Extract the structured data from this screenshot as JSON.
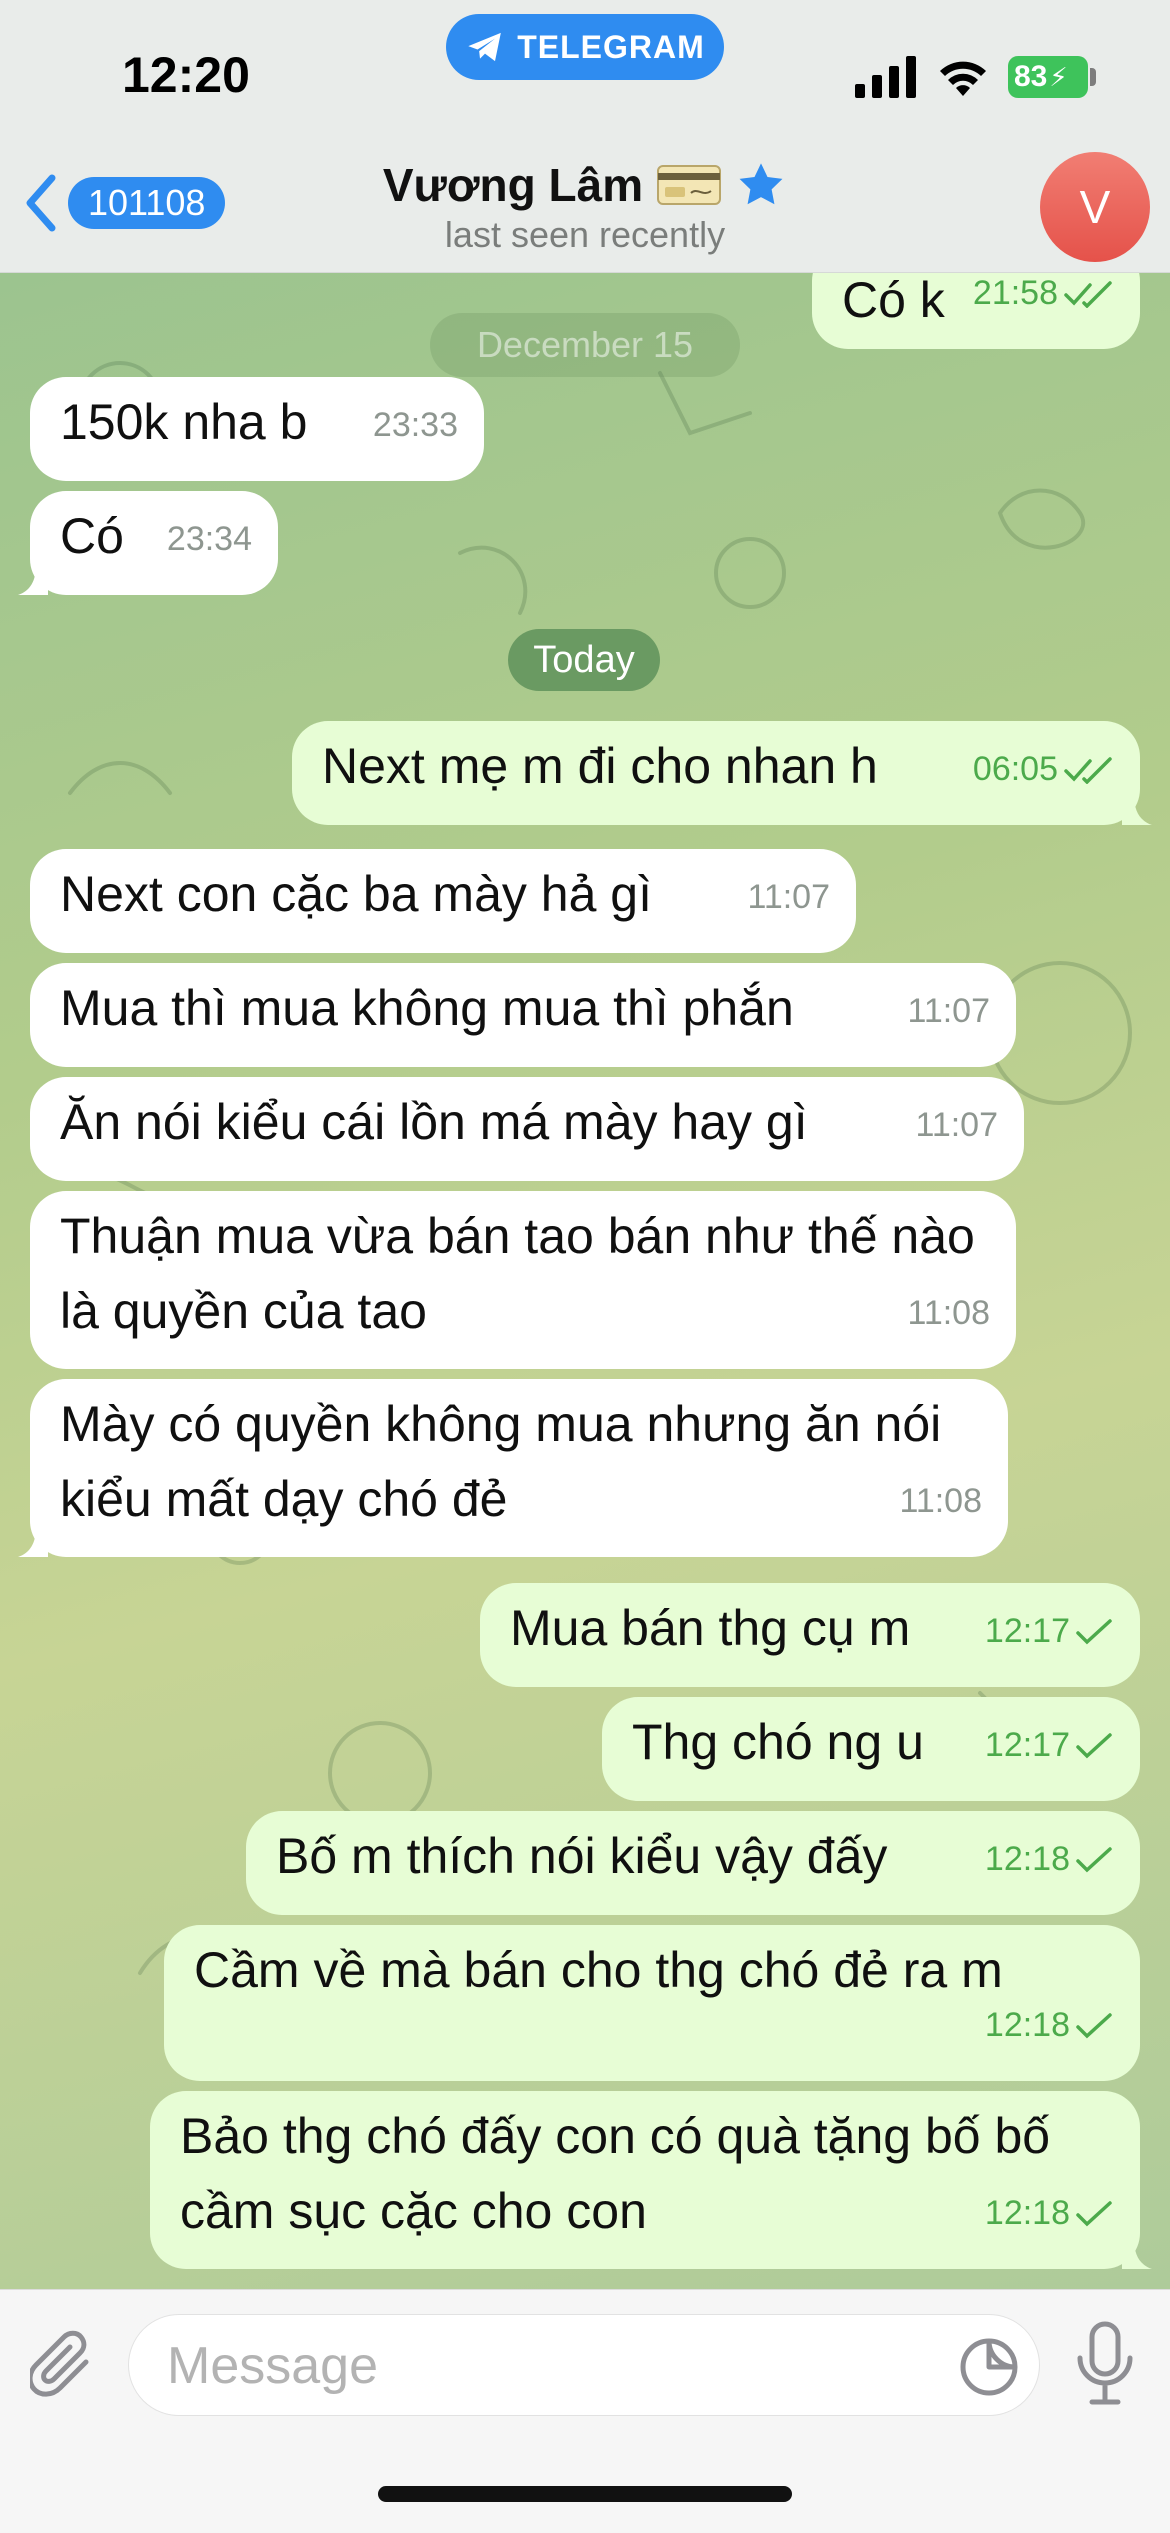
{
  "status_bar": {
    "time": "12:20",
    "app_pill": "TELEGRAM",
    "battery": "83"
  },
  "header": {
    "back_count": "101108",
    "name": "Vương Lâm",
    "status": "last seen recently",
    "avatar_letter": "V"
  },
  "chat": {
    "faded_date": "December 15",
    "date_separator": "Today",
    "messages": [
      {
        "dir": "out",
        "text": "Có k",
        "time": "21:58",
        "read": "double"
      },
      {
        "dir": "in",
        "text": "150k nha b",
        "time": "23:33"
      },
      {
        "dir": "in",
        "text": "Có",
        "time": "23:34"
      },
      {
        "dir": "out",
        "text": "Next mẹ m đi cho nhan h",
        "time": "06:05",
        "read": "double"
      },
      {
        "dir": "in",
        "text": "Next con cặc ba mày hả gì",
        "time": "11:07"
      },
      {
        "dir": "in",
        "text": "Mua thì mua không mua thì phắn",
        "time": "11:07"
      },
      {
        "dir": "in",
        "text": "Ăn nói kiểu cái lồn má mày hay gì",
        "time": "11:07"
      },
      {
        "dir": "in",
        "text": "Thuận mua vừa bán tao bán như thế nào là quyền của tao",
        "time": "11:08"
      },
      {
        "dir": "in",
        "text": "Mày có quyền không mua nhưng ăn nói kiểu mất dạy chó đẻ",
        "time": "11:08"
      },
      {
        "dir": "out",
        "text": "Mua bán thg cụ m",
        "time": "12:17",
        "read": "single"
      },
      {
        "dir": "out",
        "text": "Thg chó ng u",
        "time": "12:17",
        "read": "single"
      },
      {
        "dir": "out",
        "text": "Bố m thích nói kiểu vậy đấy",
        "time": "12:18",
        "read": "single"
      },
      {
        "dir": "out",
        "text": "Cầm về mà bán cho thg chó đẻ ra m",
        "time": "12:18",
        "read": "single"
      },
      {
        "dir": "out",
        "text": "Bảo thg chó đấy con có quà tặng bố bố cầm sục cặc cho con",
        "time": "12:18",
        "read": "single"
      }
    ]
  },
  "input": {
    "placeholder": "Message"
  },
  "icons": {
    "back": "chevron-left-icon",
    "card": "card-emoji-icon",
    "star": "star-icon",
    "attach": "paperclip-icon",
    "sticker": "sticker-icon",
    "mic": "microphone-icon"
  },
  "colors": {
    "accent": "#2f8cf0",
    "outgoing_bubble": "#e7fdd5",
    "incoming_bubble": "#ffffff",
    "checkmark": "#4caa4b",
    "avatar": "#e8584f",
    "date_pill": "#6a9a62"
  }
}
